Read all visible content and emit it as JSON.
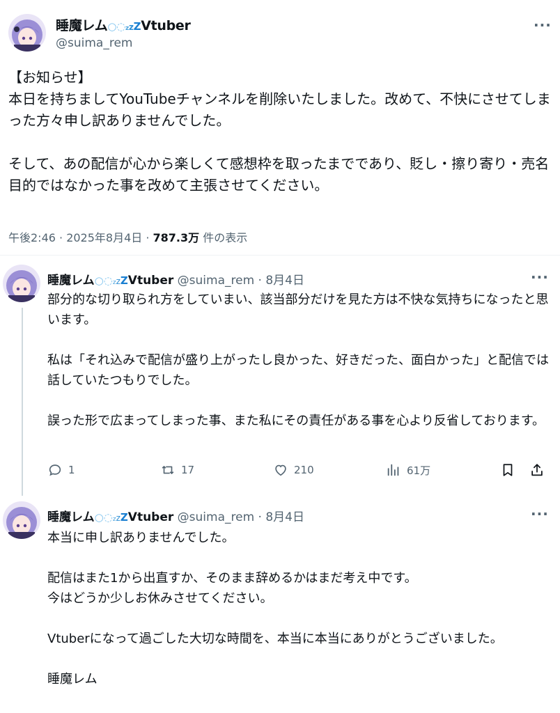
{
  "main": {
    "name": "睡魔レム",
    "name_suffix": "Vtuber",
    "handle": "@suima_rem",
    "text": "【お知らせ】\n本日を持ちましてYouTubeチャンネルを削除いたしました。改めて、不快にさせてしまった方々申し訳ありませんでした。\n\nそして、あの配信が心から楽しくて感想枠を取ったまでであり、貶し・擦り寄り・売名目的ではなかった事を改めて主張させてください。",
    "time": "午後2:46 · 2025年8月4日 · ",
    "views": "787.3万",
    "views_label": " 件の表示"
  },
  "reply1": {
    "name": "睡魔レム",
    "name_suffix": "Vtuber",
    "handle": "@suima_rem · 8月4日",
    "text": "部分的な切り取られ方をしていまい、該当部分だけを見た方は不快な気持ちになったと思います。\n\n私は「それ込みで配信が盛り上がったし良かった、好きだった、面白かった」と配信では話していたつもりでした。\n\n誤った形で広まってしまった事、また私にその責任がある事を心より反省しております。",
    "replies": "1",
    "reposts": "17",
    "likes": "210",
    "views": "61万"
  },
  "reply2": {
    "name": "睡魔レム",
    "name_suffix": "Vtuber",
    "handle": "@suima_rem · 8月4日",
    "text": "本当に申し訳ありませんでした。\n\n配信はまた1から出直すか、そのまま辞めるかはまだ考え中です。\n今はどうか少しお休みさせてください。\n\nVtuberになって過ごした大切な時間を、本当に本当にありがとうございました。\n\n睡魔レム"
  },
  "icons": {
    "more": "more-dots-icon",
    "reply": "reply-icon",
    "repost": "repost-icon",
    "like": "heart-icon",
    "views": "views-chart-icon",
    "bookmark": "bookmark-icon",
    "share": "share-icon"
  },
  "colors": {
    "text": "#0f1419",
    "secondary": "#536471",
    "thread_line": "#cfd9de",
    "avatar_hair": "#9b8fd6"
  }
}
